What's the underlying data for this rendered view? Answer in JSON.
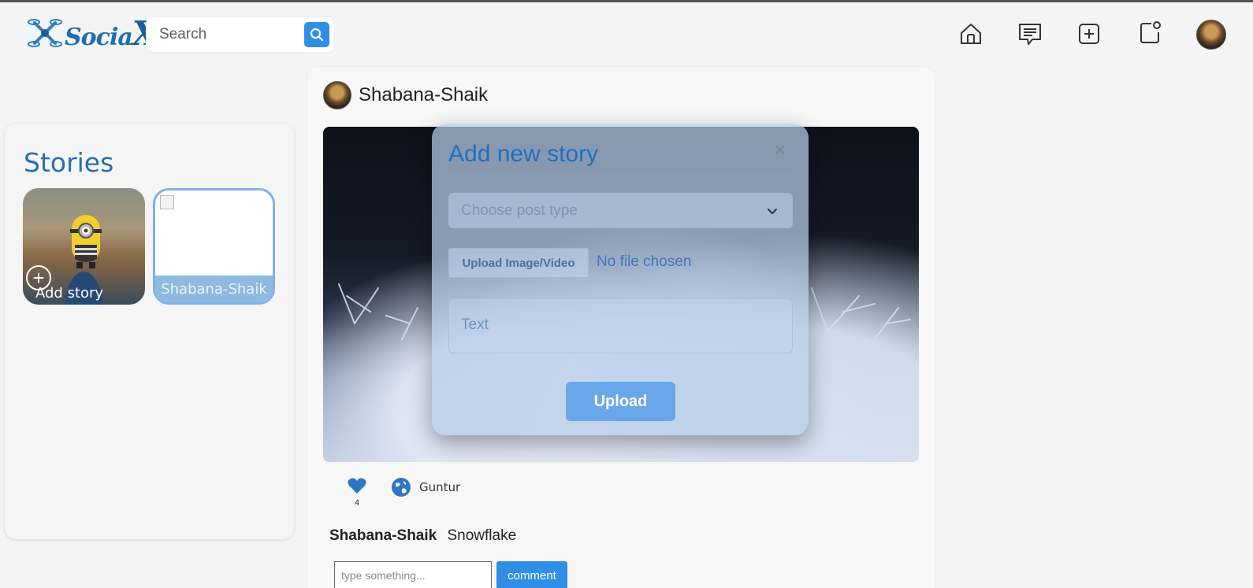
{
  "app": {
    "logo_text": "Socia",
    "logo_x": "X"
  },
  "search": {
    "placeholder": "Search"
  },
  "nav": {
    "icons": [
      "home-icon",
      "messages-icon",
      "add-post-icon",
      "notifications-icon"
    ]
  },
  "stories": {
    "title": "Stories",
    "items": [
      {
        "label": "Add story"
      },
      {
        "label": "Shabana-Shaik"
      }
    ]
  },
  "post": {
    "username": "Shabana-Shaik",
    "likes": "4",
    "location": "Guntur",
    "caption_user": "Shabana-Shaik",
    "caption_text": "Snowflake",
    "comment_placeholder": "type something...",
    "comment_button": "comment"
  },
  "modal": {
    "title": "Add new story",
    "close": "×",
    "select_placeholder": "Choose post type",
    "upload_file_label": "Upload Image/Video",
    "file_status": "No file chosen",
    "text_placeholder": "Text",
    "upload_button": "Upload"
  },
  "colors": {
    "accent": "#2f8fe6",
    "brand": "#1f6fb0",
    "modal_bg": "#b7cde8"
  }
}
